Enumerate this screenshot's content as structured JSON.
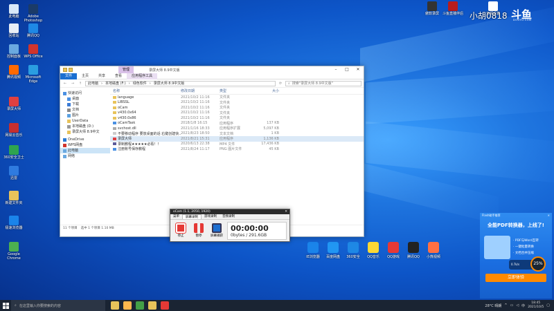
{
  "desktop": {
    "left_icons": [
      {
        "label": "此电脑",
        "color": "#d8e8f8"
      },
      {
        "label": "Adobe Photoshop",
        "color": "#1b3b68"
      },
      {
        "label": "回收站",
        "color": "#e8eef6"
      },
      {
        "label": "腾讯QQ",
        "color": "#1e88e5"
      },
      {
        "label": "控制面板",
        "color": "#6aa9e0"
      },
      {
        "label": "WPS Office",
        "color": "#d0342c"
      },
      {
        "label": "腾讯视频",
        "color": "#ff6a00"
      },
      {
        "label": "Microsoft Edge",
        "color": "#2a9de0"
      },
      {
        "label": "录屏大师",
        "color": "#e04040"
      },
      {
        "label": "网易云音乐",
        "color": "#c62f2f"
      },
      {
        "label": "360安全卫士",
        "color": "#2ea44f"
      },
      {
        "label": "迅雷",
        "color": "#2f7be0"
      },
      {
        "label": "新建文件夹",
        "color": "#e8c35a"
      },
      {
        "label": "极速浏览器",
        "color": "#1a84ea"
      },
      {
        "label": "Google Chrome",
        "color": "#4caf50"
      }
    ],
    "right_icons": [
      {
        "label": "傲软录屏",
        "color": "#333333"
      },
      {
        "label": "斗鱼直播伴侣",
        "color": "#b71c1c"
      },
      {
        "label": "音频设置",
        "color": "#ffffff"
      }
    ],
    "bottom_icons": [
      {
        "label": "IE浏览器",
        "color": "#1a84ea"
      },
      {
        "label": "百度网盘",
        "color": "#2196f3"
      },
      {
        "label": "360安全",
        "color": "#1e88e5"
      },
      {
        "label": "QQ音乐",
        "color": "#fdd835"
      },
      {
        "label": "QQ游戏",
        "color": "#e53935"
      },
      {
        "label": "腾讯QQ",
        "color": "#222222"
      },
      {
        "label": "小熊视频",
        "color": "#ff7043"
      }
    ]
  },
  "douyu": {
    "name": "小胡0818",
    "logo": "斗鱼",
    "sub": "DOUYU.COM"
  },
  "explorer": {
    "manage_tab": "管理",
    "title": "录屏大师 8.9中文版",
    "ribbon": [
      "文件",
      "主页",
      "共享",
      "查看",
      "应用程序工具"
    ],
    "path": [
      "此电脑",
      "本地磁盘 (F:)",
      "绿色软件",
      "录屏大师 8.9中文版"
    ],
    "search_placeholder": "搜索\"录屏大师 8.9中文版\"",
    "columns": {
      "name": "名称",
      "date": "修改日期",
      "type": "类型",
      "size": "大小"
    },
    "nav": [
      {
        "label": "快速访问",
        "color": "#4a90e2"
      },
      {
        "label": "桌面",
        "color": "#4a90e2"
      },
      {
        "label": "下载",
        "color": "#3a7bd5"
      },
      {
        "label": "文档",
        "color": "#888888"
      },
      {
        "label": "图片",
        "color": "#5aa0e0"
      },
      {
        "label": "UserData",
        "color": "#e8c35a"
      },
      {
        "label": "本地磁盘 (D:)",
        "color": "#999999"
      },
      {
        "label": "录屏大师 8.9中文",
        "color": "#e8c35a"
      },
      {
        "label": "OneDrive",
        "color": "#2a7bd5"
      },
      {
        "label": "WPS网盘",
        "color": "#d0342c"
      },
      {
        "label": "此电脑",
        "color": "#6aa9e0"
      },
      {
        "label": "网络",
        "color": "#6aa9e0"
      }
    ],
    "files": [
      {
        "name": "language",
        "date": "2021/10/2 11:16",
        "type": "文件夹",
        "size": "",
        "color": "#e8c35a"
      },
      {
        "name": "LIBSSL",
        "date": "2021/10/2 11:16",
        "type": "文件夹",
        "size": "",
        "color": "#e8c35a"
      },
      {
        "name": "oCam",
        "date": "2021/10/2 11:16",
        "type": "文件夹",
        "size": "",
        "color": "#e8c35a"
      },
      {
        "name": "v430.0x64",
        "date": "2021/10/2 11:16",
        "type": "文件夹",
        "size": "",
        "color": "#e8c35a"
      },
      {
        "name": "v430.0x86",
        "date": "2021/10/2 11:16",
        "type": "文件夹",
        "size": "",
        "color": "#e8c35a"
      },
      {
        "name": "oCamTask",
        "date": "2018/1/8 16:15",
        "type": "应用程序",
        "size": "137 KB",
        "color": "#4a90e2"
      },
      {
        "name": "svchost.dll",
        "date": "2021/1/16 18:33",
        "type": "应用程序扩展",
        "size": "5,097 KB",
        "color": "#aaaaaa"
      },
      {
        "name": "不要移动程序 要放桌面的话 右键创建快...",
        "date": "2021/8/23 18:50",
        "type": "文本文档",
        "size": "1 KB",
        "color": "#cccccc"
      },
      {
        "name": "录屏大师",
        "date": "2021/8/21 15:31",
        "type": "应用程序",
        "size": "1,136 KB",
        "color": "#e04040"
      },
      {
        "name": "录制教程★★★★★必看！！",
        "date": "2020/6/13 22:38",
        "type": "MP4 文件",
        "size": "17,436 KB",
        "color": "#5a5a9a"
      },
      {
        "name": "注册账号保存教程",
        "date": "2021/8/24 11:17",
        "type": "PNG 图片文件",
        "size": "45 KB",
        "color": "#4a90e2"
      }
    ],
    "selected_file_index": 8,
    "status_count": "11 个项目",
    "status_sel": "选中 1 个项目  1.10 MB"
  },
  "ocam": {
    "title": "oCam (1.1, 2050, 1920)",
    "menu": [
      "菜单",
      "屏幕录制",
      "游戏录制",
      "音频录制"
    ],
    "active_menu_index": 1,
    "buttons": [
      {
        "label": "停止",
        "color": "#e53935"
      },
      {
        "label": "暂停",
        "color": "#e53935"
      },
      {
        "label": "屏幕捕获",
        "color": "#1e6fd0"
      }
    ],
    "time": "00:00:00",
    "size": "0bytes / 291.6GB"
  },
  "pdf_popup": {
    "header": "Flash助手推荐",
    "close": "×",
    "title": "全能PDF转换器，上线了!",
    "bullets": [
      "· PDF与Word互转",
      "· 一键批量转换",
      "· 文档合并压缩"
    ],
    "speed": "0.7k/s",
    "percent": "25%",
    "cta": "立即体验"
  },
  "taskbar": {
    "search_placeholder": "在这里输入你要搜索的内容",
    "apps": [
      "#e8c35a",
      "#ffb74d",
      "#43a047",
      "#e8c35a",
      "#e53935"
    ],
    "weather": "28°C 晴朗",
    "ime": "中",
    "time": "18:45",
    "date": "2021/10/5"
  }
}
